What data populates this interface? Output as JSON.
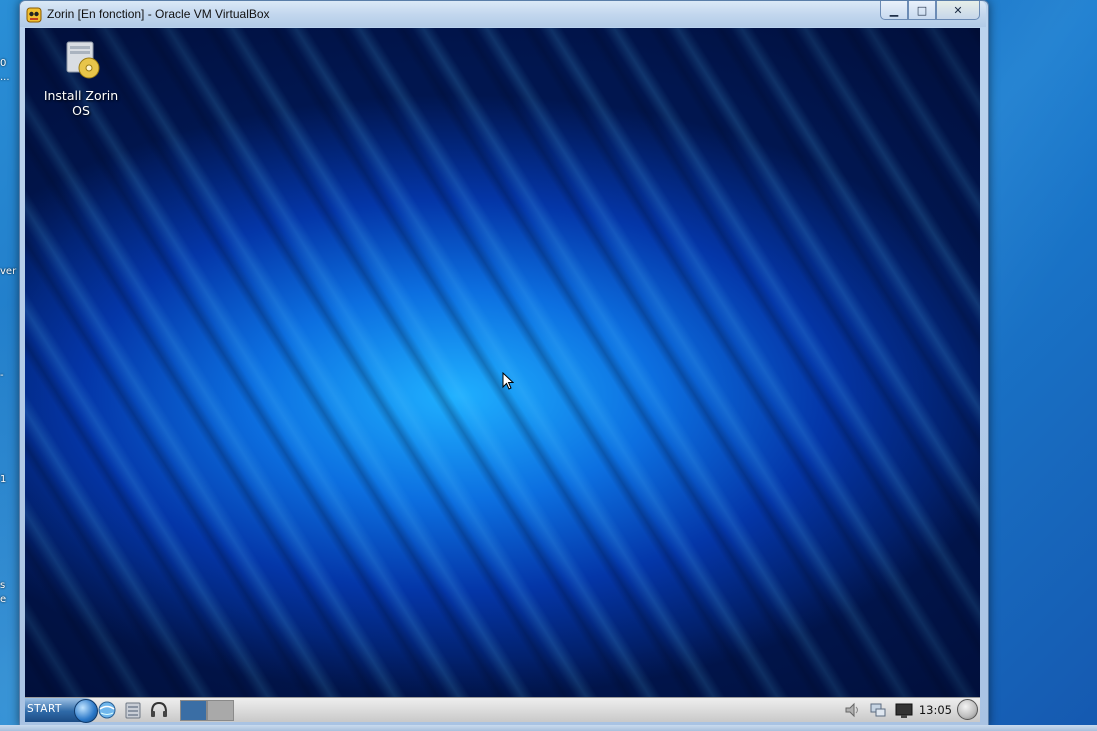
{
  "window": {
    "title": "Zorin [En fonction] - Oracle VM VirtualBox",
    "minimize_label": "▁",
    "maximize_label": "□",
    "close_label": "✕"
  },
  "host": {
    "edge_texts": [
      "0",
      "...",
      "ver",
      "-",
      "1",
      "s",
      "e"
    ]
  },
  "guest": {
    "desktop_icons": [
      {
        "label": "Install Zorin OS",
        "icon": "installer-disc-icon"
      }
    ],
    "taskbar": {
      "start_label": "START",
      "launchers": [
        "browser-icon",
        "file-manager-icon",
        "media-headphones-icon"
      ],
      "workspaces": [
        "workspace-1",
        "workspace-2"
      ],
      "tray_icons": [
        "volume-icon",
        "network-icon",
        "display-icon"
      ],
      "clock": "13:05"
    }
  },
  "colors": {
    "accent": "#1b7ed0",
    "guest_wallpaper_core": "#1fb0ff",
    "guest_wallpaper_dark": "#01164f"
  }
}
